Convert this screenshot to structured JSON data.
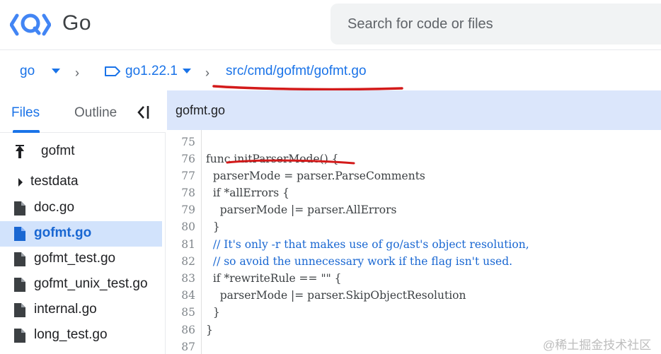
{
  "header": {
    "app_title": "Go",
    "logo": "code-search-logo",
    "search_placeholder": "Search for code or files"
  },
  "breadcrumb": {
    "repo": "go",
    "ref": "go1.22.1",
    "path": "src/cmd/gofmt/gofmt.go",
    "annotation_color": "#d31a1a"
  },
  "sidebar": {
    "tabs": {
      "files": "Files",
      "outline": "Outline"
    },
    "items": [
      {
        "label": "gofmt",
        "icon": "folder-up-icon"
      },
      {
        "label": "testdata",
        "icon": "expand-arrow-icon"
      },
      {
        "label": "doc.go",
        "icon": "file-icon"
      },
      {
        "label": "gofmt.go",
        "icon": "file-icon",
        "selected": true
      },
      {
        "label": "gofmt_test.go",
        "icon": "file-icon"
      },
      {
        "label": "gofmt_unix_test.go",
        "icon": "file-icon"
      },
      {
        "label": "internal.go",
        "icon": "file-icon"
      },
      {
        "label": "long_test.go",
        "icon": "file-icon"
      }
    ]
  },
  "code": {
    "filename": "gofmt.go",
    "lines": [
      {
        "n": "75",
        "text": ""
      },
      {
        "n": "76",
        "text": "func initParserMode() {"
      },
      {
        "n": "77",
        "text": "  parserMode = parser.ParseComments"
      },
      {
        "n": "78",
        "text": "  if *allErrors {"
      },
      {
        "n": "79",
        "text": "    parserMode |= parser.AllErrors"
      },
      {
        "n": "80",
        "text": "  }"
      },
      {
        "n": "81",
        "text": "  // It's only -r that makes use of go/ast's object resolution,"
      },
      {
        "n": "82",
        "text": "  // so avoid the unnecessary work if the flag isn't used."
      },
      {
        "n": "83",
        "text": "  if *rewriteRule == \"\" {"
      },
      {
        "n": "84",
        "text": "    parserMode |= parser.SkipObjectResolution"
      },
      {
        "n": "85",
        "text": "  }"
      },
      {
        "n": "86",
        "text": "}"
      },
      {
        "n": "87",
        "text": ""
      }
    ]
  },
  "watermark": "@稀土掘金技术社区"
}
